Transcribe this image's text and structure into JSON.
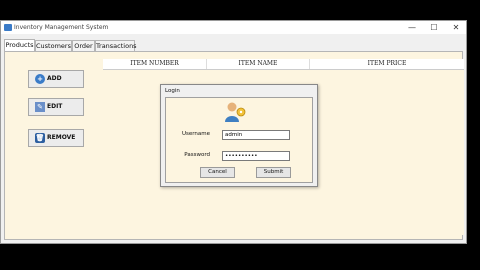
{
  "app": {
    "title": "Inventory Management System",
    "controls": {
      "minimize": "—",
      "maximize": "☐",
      "close": "✕"
    }
  },
  "tabs": [
    {
      "label": "Products",
      "active": true
    },
    {
      "label": "Customers",
      "active": false
    },
    {
      "label": "Order",
      "active": false
    },
    {
      "label": "Transactions",
      "active": false
    }
  ],
  "sidebar": {
    "add_label": "ADD",
    "add_icon": "plus-circle-icon",
    "edit_label": "EDIT",
    "edit_icon": "edit-icon",
    "remove_label": "REMOVE",
    "remove_icon": "trash-icon"
  },
  "table": {
    "columns": [
      "ITEM NUMBER",
      "ITEM NAME",
      "ITEM PRICE"
    ]
  },
  "login": {
    "title": "Login",
    "username_label": "Username",
    "username_value": "admin",
    "password_label": "Password",
    "password_value": "••••••••••",
    "cancel_label": "Cancel",
    "submit_label": "Submit"
  },
  "colors": {
    "content_bg": "#fdf5e0",
    "accent_blue": "#3a7bc8"
  }
}
